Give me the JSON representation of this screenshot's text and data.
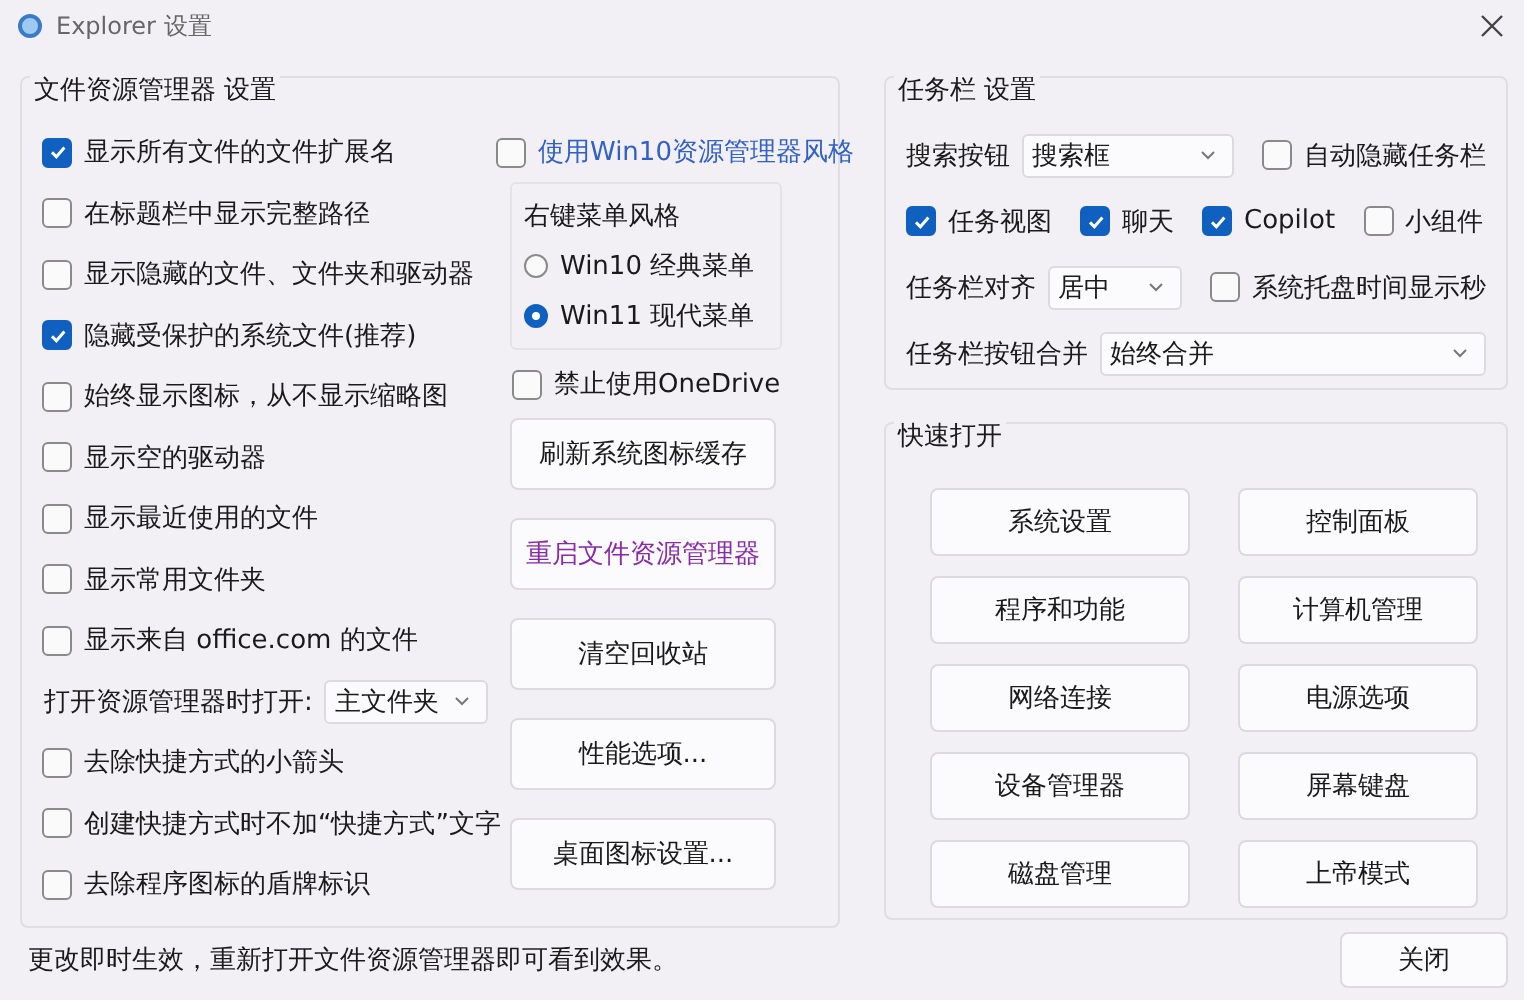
{
  "window": {
    "title": "Explorer 设置"
  },
  "explorer_group": {
    "title": "文件资源管理器 设置",
    "options": [
      {
        "kind": "checkbox",
        "label": "显示所有文件的文件扩展名",
        "checked": true
      },
      {
        "kind": "checkbox",
        "label": "在标题栏中显示完整路径",
        "checked": false
      },
      {
        "kind": "checkbox",
        "label": "显示隐藏的文件、文件夹和驱动器",
        "checked": false
      },
      {
        "kind": "checkbox",
        "label": "隐藏受保护的系统文件(推荐)",
        "checked": true
      },
      {
        "kind": "checkbox",
        "label": "始终显示图标，从不显示缩略图",
        "checked": false
      },
      {
        "kind": "checkbox",
        "label": "显示空的驱动器",
        "checked": false
      },
      {
        "kind": "checkbox",
        "label": "显示最近使用的文件",
        "checked": false
      },
      {
        "kind": "checkbox",
        "label": "显示常用文件夹",
        "checked": false
      },
      {
        "kind": "checkbox",
        "label": "显示来自 office.com 的文件",
        "checked": false
      },
      {
        "kind": "dropdown",
        "label": "打开资源管理器时打开:",
        "value": "主文件夹"
      },
      {
        "kind": "checkbox",
        "label": "去除快捷方式的小箭头",
        "checked": false
      },
      {
        "kind": "checkbox",
        "label": "创建快捷方式时不加“快捷方式”文字",
        "checked": false
      },
      {
        "kind": "checkbox",
        "label": "去除程序图标的盾牌标识",
        "checked": false
      }
    ],
    "win10_style": {
      "label": "使用Win10资源管理器风格",
      "checked": false
    },
    "context_menu": {
      "title": "右键菜单风格",
      "options": [
        {
          "label": "Win10 经典菜单",
          "selected": false
        },
        {
          "label": "Win11 现代菜单",
          "selected": true
        }
      ]
    },
    "disable_onedrive": {
      "label": "禁止使用OneDrive",
      "checked": false
    },
    "buttons": [
      {
        "label": "刷新系统图标缓存",
        "emphasized": false
      },
      {
        "label": "重启文件资源管理器",
        "emphasized": true
      },
      {
        "label": "清空回收站",
        "emphasized": false
      },
      {
        "label": "性能选项...",
        "emphasized": false
      },
      {
        "label": "桌面图标设置...",
        "emphasized": false
      }
    ]
  },
  "taskbar_group": {
    "title": "任务栏 设置",
    "search": {
      "label": "搜索按钮",
      "value": "搜索框"
    },
    "auto_hide": {
      "label": "自动隐藏任务栏",
      "checked": false
    },
    "toggles": [
      {
        "label": "任务视图",
        "checked": true
      },
      {
        "label": "聊天",
        "checked": true
      },
      {
        "label": "Copilot",
        "checked": true
      },
      {
        "label": "小组件",
        "checked": false
      }
    ],
    "alignment": {
      "label": "任务栏对齐",
      "value": "居中"
    },
    "clock_seconds": {
      "label": "系统托盘时间显示秒",
      "checked": false
    },
    "combine": {
      "label": "任务栏按钮合并",
      "value": "始终合并"
    }
  },
  "quick_open": {
    "title": "快速打开",
    "buttons": [
      "系统设置",
      "控制面板",
      "程序和功能",
      "计算机管理",
      "网络连接",
      "电源选项",
      "设备管理器",
      "屏幕键盘",
      "磁盘管理",
      "上帝模式"
    ]
  },
  "status_text": "更改即时生效，重新打开文件资源管理器即可看到效果。",
  "close_button": "关闭"
}
